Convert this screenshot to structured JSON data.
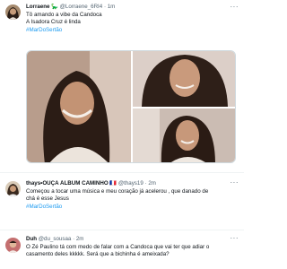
{
  "tweets": [
    {
      "name": "Lorraene 🦕",
      "handle": "@Lorraene_6RI4",
      "sep": "·",
      "time": "1m",
      "lines": [
        "Tô amando a vibe da Candoca",
        "A Isadora Cruz é linda"
      ],
      "hashtag": "#MarDoSertão"
    },
    {
      "name": "thays•OUÇA ÁLBUM CAMINHO 🇫🇷",
      "handle": "@thays19",
      "sep": "·",
      "time": "2m",
      "lines": [
        "Começou a tocar uma música e meu coração já acelerou , que danado de",
        "chá é esse Jesus"
      ],
      "hashtag": "#MarDoSertão"
    },
    {
      "name": "Duh",
      "handle": "@du_sousaa",
      "sep": "·",
      "time": "2m",
      "lines": [
        "O Zé Paulino tá com medo de falar com a Candoca que vai ter que adiar o",
        "casamento deles kkkkk. Será que a bichinha é ameixada?"
      ],
      "hashtag": ""
    }
  ],
  "more_label": "···",
  "colors": {
    "link": "#1d9bf0",
    "muted": "#536471",
    "border": "#eff3f4"
  }
}
